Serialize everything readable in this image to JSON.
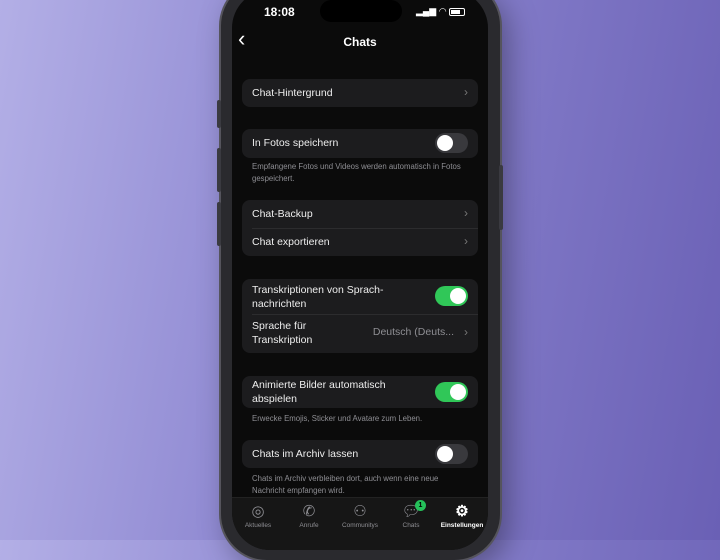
{
  "status": {
    "time": "18:08"
  },
  "nav": {
    "title": "Chats",
    "back": "‹"
  },
  "rows": {
    "wallpaper": "Chat-Hintergrund",
    "save_photos": "In Fotos speichern",
    "save_photos_on": false,
    "save_photos_note": "Empfangene Fotos und Videos werden automatisch in Fotos gespeichert.",
    "backup": "Chat-Backup",
    "export": "Chat exportieren",
    "transcriptions": "Transkriptionen von Sprach-nachrichten",
    "transcriptions_on": true,
    "language_label": "Sprache für Transkription",
    "language_value": "Deutsch (Deuts...",
    "animated": "Animierte Bilder automatisch abspielen",
    "animated_on": true,
    "animated_note": "Erwecke Emojis, Sticker und Avatare zum Leben.",
    "archive": "Chats im Archiv lassen",
    "archive_on": false,
    "archive_note": "Chats im Archiv verbleiben dort, auch wenn eine neue Nachricht empfangen wird."
  },
  "tabs": [
    {
      "label": "Aktuelles",
      "icon": "updates-icon"
    },
    {
      "label": "Anrufe",
      "icon": "phone-icon"
    },
    {
      "label": "Communitys",
      "icon": "communities-icon"
    },
    {
      "label": "Chats",
      "icon": "chat-icon",
      "badge": "1"
    },
    {
      "label": "Einstellungen",
      "icon": "settings-icon",
      "active": true
    }
  ],
  "colors": {
    "toggle_on": "#30c758",
    "badge": "#25c05a"
  }
}
